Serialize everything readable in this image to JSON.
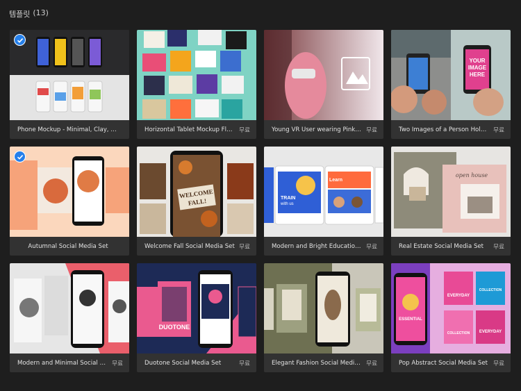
{
  "header": {
    "label": "템플릿",
    "count": "(13)"
  },
  "free_label": "무료",
  "colors": {
    "accent": "#2680eb",
    "background": "#1e1e1e",
    "card": "#323232"
  },
  "icons": {
    "selected": "checkmark-icon"
  },
  "templates": [
    {
      "title": "Phone Mockup - Minimal, Clay, Black,...",
      "free": "",
      "selected": true
    },
    {
      "title": "Horizontal Tablet Mockup Flyer Set",
      "free": "무료",
      "selected": false
    },
    {
      "title": "Young VR User wearing Pink Swe...",
      "free": "무료",
      "selected": false
    },
    {
      "title": "Two Images of a Person Holding...",
      "free": "무료",
      "selected": false
    },
    {
      "title": "Autumnal Social Media Set",
      "free": "",
      "selected": true
    },
    {
      "title": "Welcome Fall Social Media Set",
      "free": "무료",
      "selected": false
    },
    {
      "title": "Modern and Bright Educational S...",
      "free": "무료",
      "selected": false
    },
    {
      "title": "Real Estate Social Media Set",
      "free": "무료",
      "selected": false
    },
    {
      "title": "Modern and Minimal Social Medi...",
      "free": "무료",
      "selected": false
    },
    {
      "title": "Duotone Social Media Set",
      "free": "무료",
      "selected": false
    },
    {
      "title": "Elegant Fashion Social Media Set",
      "free": "무료",
      "selected": false
    },
    {
      "title": "Pop Abstract Social Media Set",
      "free": "무료",
      "selected": false
    }
  ],
  "thumb_text": {
    "welcome": "WELCOME",
    "fall": "FALL!",
    "duotone": "DUOTONE",
    "open_house": "open house",
    "your_image": "YOUR",
    "image": "IMAGE",
    "here": "HERE",
    "train": "TRAIN",
    "with_us": "with us",
    "learn": "Learn",
    "everyday": "EVERYDAY",
    "collection": "COLLECTION",
    "essential": "ESSENTIAL"
  }
}
